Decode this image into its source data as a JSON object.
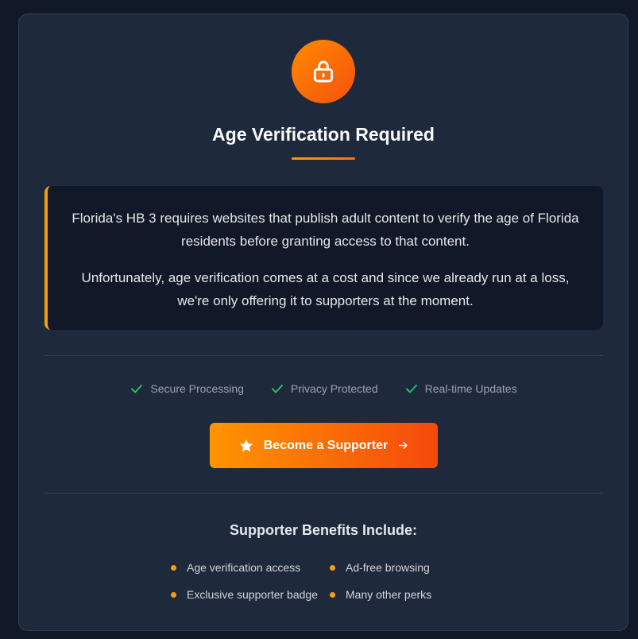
{
  "header": {
    "title": "Age Verification Required"
  },
  "notice": {
    "paragraph1": "Florida's HB 3 requires websites that publish adult content to verify the age of Florida residents before granting access to that content.",
    "paragraph2": "Unfortunately, age verification comes at a cost and since we already run at a loss, we're only offering it to supporters at the moment."
  },
  "features": [
    {
      "label": "Secure Processing",
      "icon": "check-icon"
    },
    {
      "label": "Privacy Protected",
      "icon": "check-icon"
    },
    {
      "label": "Real-time Updates",
      "icon": "check-icon"
    }
  ],
  "cta": {
    "label": "Become a Supporter",
    "left_icon": "star-icon",
    "right_icon": "arrow-right-icon"
  },
  "benefits": {
    "title": "Supporter Benefits Include:",
    "items": [
      "Age verification access",
      "Ad-free browsing",
      "Exclusive supporter badge",
      "Many other perks"
    ]
  },
  "colors": {
    "background": "#111827",
    "card": "#1e293b",
    "accent_orange": "#f59e0b",
    "accent_gradient_end": "#f5490b",
    "check_green": "#22c55e"
  }
}
